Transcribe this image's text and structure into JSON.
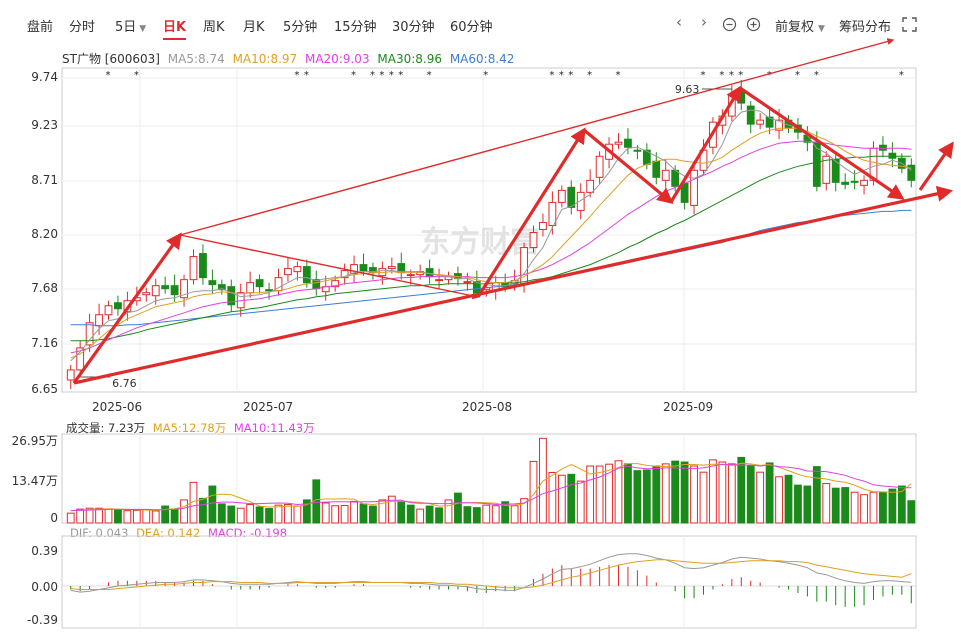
{
  "toolbar": {
    "tabs": [
      "盘前",
      "分时",
      "5日",
      "日K",
      "周K",
      "月K",
      "5分钟",
      "15分钟",
      "30分钟",
      "60分钟"
    ],
    "active_tab": "日K",
    "fuquan": "前复权",
    "chip": "筹码分布"
  },
  "stock": {
    "label": "ST广物 [600603]",
    "ma5": "MA5:8.74",
    "ma10": "MA10:8.97",
    "ma20": "MA20:9.03",
    "ma30": "MA30:8.96",
    "ma60": "MA60:8.42"
  },
  "volume": {
    "label": "成交量: 7.23万",
    "ma5": "MA5:12.78万",
    "ma10": "MA10:11.43万"
  },
  "macd": {
    "dif": "DIF: 0.043",
    "dea": "DEA: 0.142",
    "macd": "MACD: -0.198"
  },
  "watermark": "东方财富",
  "colors": {
    "up": "#e02b2b",
    "down": "#1a8a1a",
    "ma5": "#999999",
    "ma10": "#e0a020",
    "ma20": "#e040e0",
    "ma30": "#1a8a1a",
    "ma60": "#3a7fd5",
    "trend": "#e02b2b"
  },
  "chart_data": {
    "type": "candlestick",
    "price_axis": {
      "ticks": [
        "9.74",
        "9.23",
        "8.71",
        "8.20",
        "7.68",
        "7.16",
        "6.65"
      ],
      "ylim": [
        6.65,
        9.74
      ]
    },
    "x_labels": [
      "2025-06",
      "2025-07",
      "2025-08",
      "2025-09"
    ],
    "annotations": {
      "high": "9.63",
      "low": "6.76"
    },
    "volume_axis": {
      "ticks": [
        "26.95万",
        "13.47万",
        "0"
      ],
      "ylim": [
        0,
        26.95
      ]
    },
    "macd_axis": {
      "ticks": [
        "0.39",
        "0.00",
        "-0.39"
      ],
      "ylim": [
        -0.39,
        0.39
      ]
    },
    "close": [
      6.83,
      7.05,
      7.3,
      7.38,
      7.47,
      7.44,
      7.52,
      7.55,
      7.6,
      7.67,
      7.64,
      7.58,
      7.73,
      7.96,
      7.75,
      7.68,
      7.63,
      7.48,
      7.6,
      7.7,
      7.66,
      7.62,
      7.75,
      7.84,
      7.86,
      7.7,
      7.64,
      7.66,
      7.72,
      7.82,
      7.88,
      7.82,
      7.8,
      7.84,
      7.86,
      7.8,
      7.78,
      7.81,
      7.76,
      7.73,
      7.76,
      7.74,
      7.71,
      7.6,
      7.65,
      7.7,
      7.66,
      7.72,
      8.05,
      8.2,
      8.3,
      8.5,
      8.62,
      8.45,
      8.6,
      8.72,
      8.96,
      9.08,
      9.1,
      9.05,
      9.02,
      8.88,
      8.75,
      8.82,
      8.66,
      8.5,
      8.82,
      9.02,
      9.3,
      9.36,
      9.58,
      9.49,
      9.28,
      9.32,
      9.25,
      9.32,
      9.24,
      9.2,
      9.1,
      8.66,
      8.96,
      8.7,
      8.68,
      8.7,
      8.72,
      9.04,
      9.02,
      8.94,
      8.84,
      8.72
    ],
    "ma5": [
      6.92,
      7.01,
      7.13,
      7.24,
      7.32,
      7.34,
      7.4,
      7.42,
      7.47,
      7.52,
      7.54,
      7.55,
      7.58,
      7.61,
      7.62,
      7.62,
      7.64,
      7.6,
      7.56,
      7.57,
      7.58,
      7.6,
      7.65,
      7.7,
      7.75,
      7.75,
      7.72,
      7.74,
      7.75,
      7.76,
      7.8,
      7.81,
      7.81,
      7.82,
      7.82,
      7.81,
      7.81,
      7.81,
      7.79,
      7.77,
      7.76,
      7.74,
      7.74,
      7.7,
      7.68,
      7.67,
      7.67,
      7.7,
      7.79,
      7.93,
      8.05,
      8.25,
      8.43,
      8.46,
      8.52,
      8.58,
      8.68,
      8.8,
      8.94,
      9.04,
      9.05,
      9.01,
      8.96,
      8.91,
      8.82,
      8.76,
      8.74,
      8.78,
      8.92,
      9.08,
      9.3,
      9.4,
      9.42,
      9.41,
      9.34,
      9.31,
      9.27,
      9.25,
      9.17,
      9.04,
      8.99,
      8.91,
      8.84,
      8.78,
      8.82,
      8.86,
      8.88,
      8.92,
      8.89,
      8.82
    ],
    "ma10": [
      6.95,
      6.99,
      7.06,
      7.14,
      7.22,
      7.28,
      7.34,
      7.38,
      7.42,
      7.46,
      7.48,
      7.5,
      7.52,
      7.56,
      7.58,
      7.59,
      7.61,
      7.6,
      7.59,
      7.6,
      7.6,
      7.61,
      7.62,
      7.64,
      7.67,
      7.69,
      7.7,
      7.72,
      7.74,
      7.76,
      7.78,
      7.79,
      7.8,
      7.8,
      7.81,
      7.8,
      7.8,
      7.8,
      7.79,
      7.78,
      7.77,
      7.76,
      7.75,
      7.73,
      7.71,
      7.7,
      7.7,
      7.72,
      7.76,
      7.82,
      7.88,
      7.96,
      8.06,
      8.16,
      8.26,
      8.36,
      8.47,
      8.57,
      8.67,
      8.77,
      8.84,
      8.88,
      8.91,
      8.93,
      8.93,
      8.91,
      8.9,
      8.89,
      8.91,
      8.95,
      9.02,
      9.08,
      9.14,
      9.19,
      9.22,
      9.24,
      9.24,
      9.24,
      9.21,
      9.16,
      9.12,
      9.07,
      9.01,
      8.96,
      8.92,
      8.9,
      8.88,
      8.87,
      8.86,
      8.84
    ],
    "ma20": [
      7.0,
      7.02,
      7.05,
      7.09,
      7.13,
      7.17,
      7.21,
      7.25,
      7.28,
      7.31,
      7.34,
      7.37,
      7.4,
      7.43,
      7.46,
      7.48,
      7.5,
      7.51,
      7.52,
      7.53,
      7.54,
      7.56,
      7.58,
      7.6,
      7.62,
      7.63,
      7.64,
      7.66,
      7.67,
      7.69,
      7.7,
      7.71,
      7.72,
      7.73,
      7.74,
      7.75,
      7.75,
      7.76,
      7.76,
      7.76,
      7.76,
      7.76,
      7.76,
      7.75,
      7.75,
      7.75,
      7.75,
      7.76,
      7.78,
      7.81,
      7.84,
      7.88,
      7.93,
      7.98,
      8.04,
      8.1,
      8.17,
      8.24,
      8.31,
      8.38,
      8.44,
      8.5,
      8.56,
      8.61,
      8.65,
      8.69,
      8.73,
      8.77,
      8.81,
      8.86,
      8.9,
      8.95,
      8.99,
      9.03,
      9.06,
      9.09,
      9.1,
      9.11,
      9.11,
      9.1,
      9.09,
      9.07,
      9.06,
      9.05,
      9.04,
      9.04,
      9.04,
      9.04,
      9.04,
      9.03
    ],
    "ma30": [
      7.12,
      7.12,
      7.12,
      7.13,
      7.14,
      7.16,
      7.18,
      7.2,
      7.23,
      7.25,
      7.27,
      7.29,
      7.31,
      7.33,
      7.35,
      7.37,
      7.39,
      7.41,
      7.42,
      7.44,
      7.45,
      7.47,
      7.49,
      7.51,
      7.53,
      7.54,
      7.56,
      7.57,
      7.59,
      7.6,
      7.61,
      7.62,
      7.63,
      7.64,
      7.65,
      7.66,
      7.67,
      7.67,
      7.68,
      7.68,
      7.69,
      7.69,
      7.69,
      7.69,
      7.69,
      7.7,
      7.7,
      7.7,
      7.71,
      7.73,
      7.74,
      7.76,
      7.79,
      7.82,
      7.85,
      7.88,
      7.92,
      7.96,
      8.0,
      8.05,
      8.09,
      8.14,
      8.19,
      8.23,
      8.28,
      8.32,
      8.37,
      8.42,
      8.47,
      8.52,
      8.57,
      8.62,
      8.67,
      8.72,
      8.76,
      8.8,
      8.83,
      8.86,
      8.88,
      8.9,
      8.92,
      8.93,
      8.94,
      8.95,
      8.95,
      8.96,
      8.96,
      8.96,
      8.96,
      8.96
    ],
    "ma60": [
      7.28,
      7.28,
      7.28,
      7.27,
      7.27,
      7.27,
      7.28,
      7.28,
      7.29,
      7.3,
      7.31,
      7.32,
      7.33,
      7.34,
      7.35,
      7.36,
      7.37,
      7.38,
      7.39,
      7.4,
      7.41,
      7.42,
      7.43,
      7.44,
      7.45,
      7.46,
      7.47,
      7.48,
      7.49,
      7.5,
      7.51,
      7.52,
      7.53,
      7.54,
      7.55,
      7.56,
      7.57,
      7.58,
      7.59,
      7.6,
      7.61,
      7.62,
      7.63,
      7.64,
      7.65,
      7.66,
      7.67,
      7.68,
      7.69,
      7.7,
      7.72,
      7.74,
      7.76,
      7.78,
      7.8,
      7.82,
      7.84,
      7.86,
      7.88,
      7.9,
      7.92,
      7.94,
      7.96,
      7.98,
      8.0,
      8.02,
      8.04,
      8.06,
      8.08,
      8.1,
      8.13,
      8.16,
      8.19,
      8.22,
      8.24,
      8.26,
      8.28,
      8.3,
      8.31,
      8.33,
      8.35,
      8.36,
      8.37,
      8.38,
      8.39,
      8.4,
      8.41,
      8.41,
      8.42,
      8.42
    ],
    "volume": [
      3.2,
      4.5,
      4.8,
      4.8,
      4.5,
      4.2,
      4.0,
      4.1,
      4.3,
      3.9,
      5.5,
      4.5,
      7.5,
      13.2,
      8.0,
      12.0,
      6.2,
      5.5,
      4.8,
      6.0,
      5.2,
      4.7,
      5.8,
      6.0,
      5.5,
      7.5,
      14.0,
      6.5,
      5.6,
      5.7,
      7.0,
      6.2,
      5.5,
      7.5,
      8.7,
      6.8,
      5.8,
      4.5,
      5.5,
      4.9,
      7.5,
      9.7,
      5.3,
      5.0,
      5.8,
      5.6,
      6.9,
      5.6,
      7.9,
      20.0,
      27.5,
      16.4,
      15.5,
      15.8,
      13.6,
      18.5,
      18.5,
      19.1,
      20.2,
      19.2,
      17.0,
      17.2,
      18.5,
      19.2,
      20.1,
      19.8,
      18.5,
      16.5,
      20.5,
      19.8,
      19.2,
      21.3,
      18.5,
      16.5,
      19.5,
      15.0,
      15.5,
      12.3,
      12.0,
      18.3,
      12.8,
      11.3,
      11.5,
      10.0,
      9.2,
      10.0,
      10.0,
      11.0,
      12.0,
      7.23
    ],
    "vol_ma5": [
      4.0,
      4.2,
      4.4,
      4.5,
      4.6,
      4.5,
      4.4,
      4.3,
      4.2,
      4.1,
      4.4,
      4.6,
      5.3,
      7.0,
      7.7,
      9.0,
      9.4,
      9.2,
      8.1,
      6.9,
      5.5,
      5.2,
      5.3,
      5.5,
      5.4,
      5.9,
      7.6,
      7.8,
      7.8,
      7.9,
      7.7,
      6.2,
      6.0,
      6.4,
      7.0,
      7.1,
      6.9,
      6.7,
      6.3,
      5.5,
      5.6,
      6.4,
      6.6,
      6.7,
      6.6,
      6.4,
      5.7,
      5.8,
      6.3,
      9.2,
      13.6,
      15.5,
      17.5,
      19.0,
      17.5,
      15.9,
      16.4,
      17.1,
      18.0,
      19.3,
      19.3,
      18.7,
      18.4,
      18.3,
      18.5,
      19.0,
      19.0,
      18.8,
      19.1,
      19.0,
      18.7,
      19.4,
      19.2,
      18.7,
      19.0,
      18.1,
      17.0,
      15.8,
      15.0,
      14.6,
      14.3,
      13.6,
      13.2,
      12.3,
      11.0,
      10.2,
      10.1,
      10.0,
      10.2,
      12.78
    ],
    "vol_ma10": [
      4.0,
      4.1,
      4.2,
      4.3,
      4.4,
      4.4,
      4.4,
      4.4,
      4.4,
      4.3,
      4.3,
      4.4,
      4.8,
      5.6,
      5.9,
      6.5,
      6.8,
      6.8,
      6.6,
      6.3,
      6.3,
      6.4,
      6.5,
      6.4,
      6.0,
      6.2,
      6.7,
      6.8,
      6.9,
      6.9,
      6.8,
      6.9,
      6.9,
      7.1,
      7.4,
      7.4,
      6.6,
      6.4,
      6.4,
      6.3,
      6.3,
      6.6,
      6.6,
      6.5,
      6.3,
      6.0,
      6.1,
      6.2,
      6.5,
      7.9,
      9.5,
      10.4,
      11.4,
      12.4,
      13.0,
      14.0,
      14.9,
      16.3,
      17.8,
      18.4,
      17.9,
      17.6,
      17.7,
      17.9,
      17.9,
      17.8,
      17.7,
      17.9,
      18.5,
      19.1,
      18.9,
      18.8,
      18.8,
      18.5,
      18.8,
      18.3,
      18.1,
      17.7,
      16.9,
      16.8,
      16.7,
      16.1,
      15.5,
      14.4,
      13.6,
      12.4,
      12.0,
      11.8,
      11.5,
      11.43
    ],
    "dif": [
      -0.05,
      -0.07,
      -0.06,
      -0.04,
      -0.02,
      0.0,
      0.01,
      0.02,
      0.03,
      0.04,
      0.04,
      0.04,
      0.05,
      0.07,
      0.07,
      0.06,
      0.05,
      0.03,
      0.02,
      0.02,
      0.02,
      0.02,
      0.03,
      0.04,
      0.05,
      0.04,
      0.03,
      0.03,
      0.03,
      0.04,
      0.05,
      0.05,
      0.04,
      0.04,
      0.04,
      0.04,
      0.03,
      0.03,
      0.02,
      0.01,
      0.01,
      0.0,
      -0.01,
      -0.03,
      -0.04,
      -0.04,
      -0.05,
      -0.05,
      -0.02,
      0.03,
      0.08,
      0.14,
      0.19,
      0.2,
      0.22,
      0.25,
      0.29,
      0.33,
      0.36,
      0.37,
      0.37,
      0.35,
      0.32,
      0.3,
      0.26,
      0.21,
      0.2,
      0.21,
      0.24,
      0.27,
      0.31,
      0.33,
      0.32,
      0.31,
      0.29,
      0.28,
      0.26,
      0.24,
      0.21,
      0.15,
      0.13,
      0.09,
      0.06,
      0.04,
      0.03,
      0.05,
      0.06,
      0.06,
      0.05,
      0.043
    ],
    "dea": [
      -0.03,
      -0.04,
      -0.04,
      -0.04,
      -0.04,
      -0.03,
      -0.02,
      -0.01,
      0.0,
      0.01,
      0.02,
      0.02,
      0.03,
      0.04,
      0.04,
      0.05,
      0.05,
      0.05,
      0.04,
      0.04,
      0.04,
      0.03,
      0.03,
      0.03,
      0.04,
      0.04,
      0.04,
      0.04,
      0.04,
      0.04,
      0.04,
      0.04,
      0.04,
      0.04,
      0.04,
      0.04,
      0.04,
      0.04,
      0.04,
      0.03,
      0.03,
      0.02,
      0.02,
      0.01,
      0.0,
      -0.01,
      -0.02,
      -0.02,
      -0.02,
      -0.01,
      0.01,
      0.04,
      0.07,
      0.1,
      0.12,
      0.15,
      0.18,
      0.21,
      0.24,
      0.26,
      0.28,
      0.29,
      0.3,
      0.3,
      0.29,
      0.28,
      0.27,
      0.26,
      0.26,
      0.26,
      0.27,
      0.28,
      0.29,
      0.29,
      0.29,
      0.29,
      0.28,
      0.28,
      0.27,
      0.24,
      0.22,
      0.2,
      0.18,
      0.16,
      0.14,
      0.13,
      0.12,
      0.11,
      0.1,
      0.142
    ],
    "macd_hist": [
      -0.04,
      -0.06,
      -0.04,
      0.0,
      0.04,
      0.06,
      0.06,
      0.06,
      0.06,
      0.06,
      0.04,
      0.04,
      0.04,
      0.06,
      0.06,
      0.02,
      0.0,
      -0.04,
      -0.04,
      -0.04,
      -0.04,
      -0.02,
      0.0,
      0.02,
      0.02,
      0.0,
      -0.02,
      -0.02,
      -0.02,
      0.0,
      0.02,
      0.02,
      0.0,
      0.0,
      0.0,
      0.0,
      -0.02,
      -0.02,
      -0.04,
      -0.04,
      -0.04,
      -0.04,
      -0.06,
      -0.08,
      -0.08,
      -0.06,
      -0.06,
      -0.06,
      0.0,
      0.08,
      0.14,
      0.2,
      0.24,
      0.2,
      0.2,
      0.2,
      0.22,
      0.24,
      0.24,
      0.22,
      0.18,
      0.12,
      0.04,
      0.0,
      -0.06,
      -0.14,
      -0.14,
      -0.1,
      -0.04,
      0.02,
      0.08,
      0.1,
      0.06,
      0.04,
      0.0,
      -0.02,
      -0.04,
      -0.08,
      -0.12,
      -0.18,
      -0.18,
      -0.22,
      -0.24,
      -0.24,
      -0.22,
      -0.16,
      -0.12,
      -0.1,
      -0.1,
      -0.198
    ]
  }
}
